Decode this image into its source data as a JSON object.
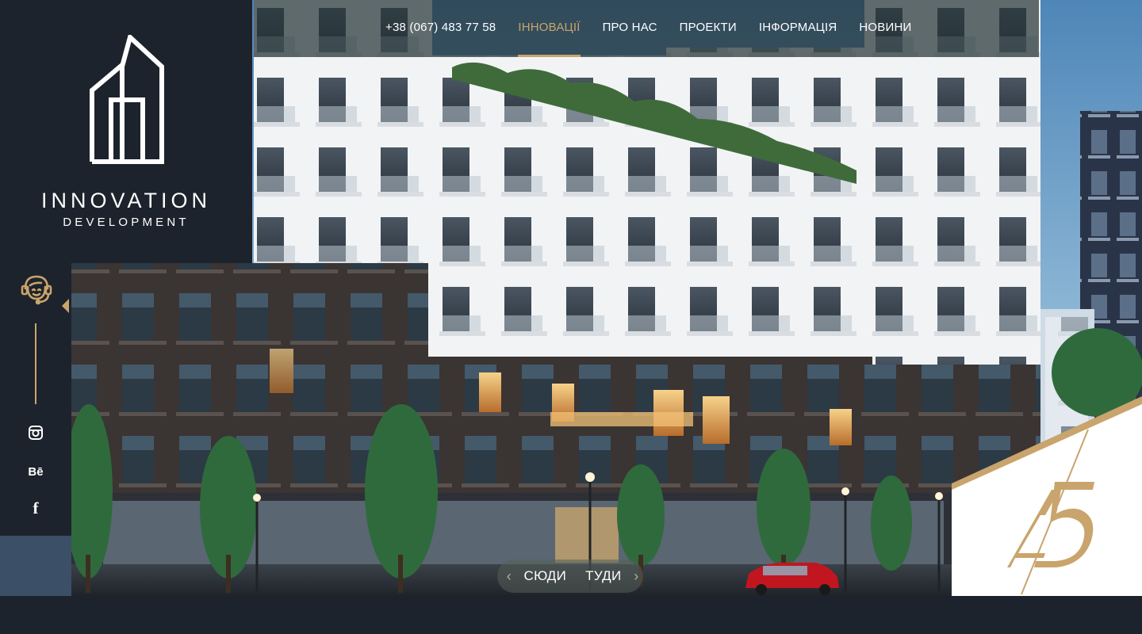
{
  "brand": {
    "line1": "INNOVATION",
    "line2": "DEVELOPMENT"
  },
  "nav": {
    "phone": "+38 (067) 483 77 58",
    "items": [
      {
        "label": "ІННОВАЦІЇ",
        "active": true
      },
      {
        "label": "ПРО НАС",
        "active": false
      },
      {
        "label": "ПРОЕКТИ",
        "active": false
      },
      {
        "label": "ІНФОРМАЦІЯ",
        "active": false
      },
      {
        "label": "НОВИНИ",
        "active": false
      }
    ]
  },
  "sidebar": {
    "support_icon": "headset-support-icon",
    "social": [
      {
        "name": "instagram",
        "icon": "instagram-icon"
      },
      {
        "name": "behance",
        "icon": "behance-icon",
        "glyph": "Bē"
      },
      {
        "name": "facebook",
        "icon": "facebook-icon",
        "glyph": "f"
      }
    ]
  },
  "slider": {
    "prev_label": "СЮДИ",
    "next_label": "ТУДИ",
    "prev_icon": "arrow-left-icon",
    "next_icon": "arrow-right-icon"
  },
  "badge": {
    "icon": "a5-monogram-icon"
  },
  "colors": {
    "accent_gold": "#c9a46c",
    "panel_dark": "#1d232c",
    "nav_bg": "#263438",
    "text_white": "#ffffff"
  }
}
